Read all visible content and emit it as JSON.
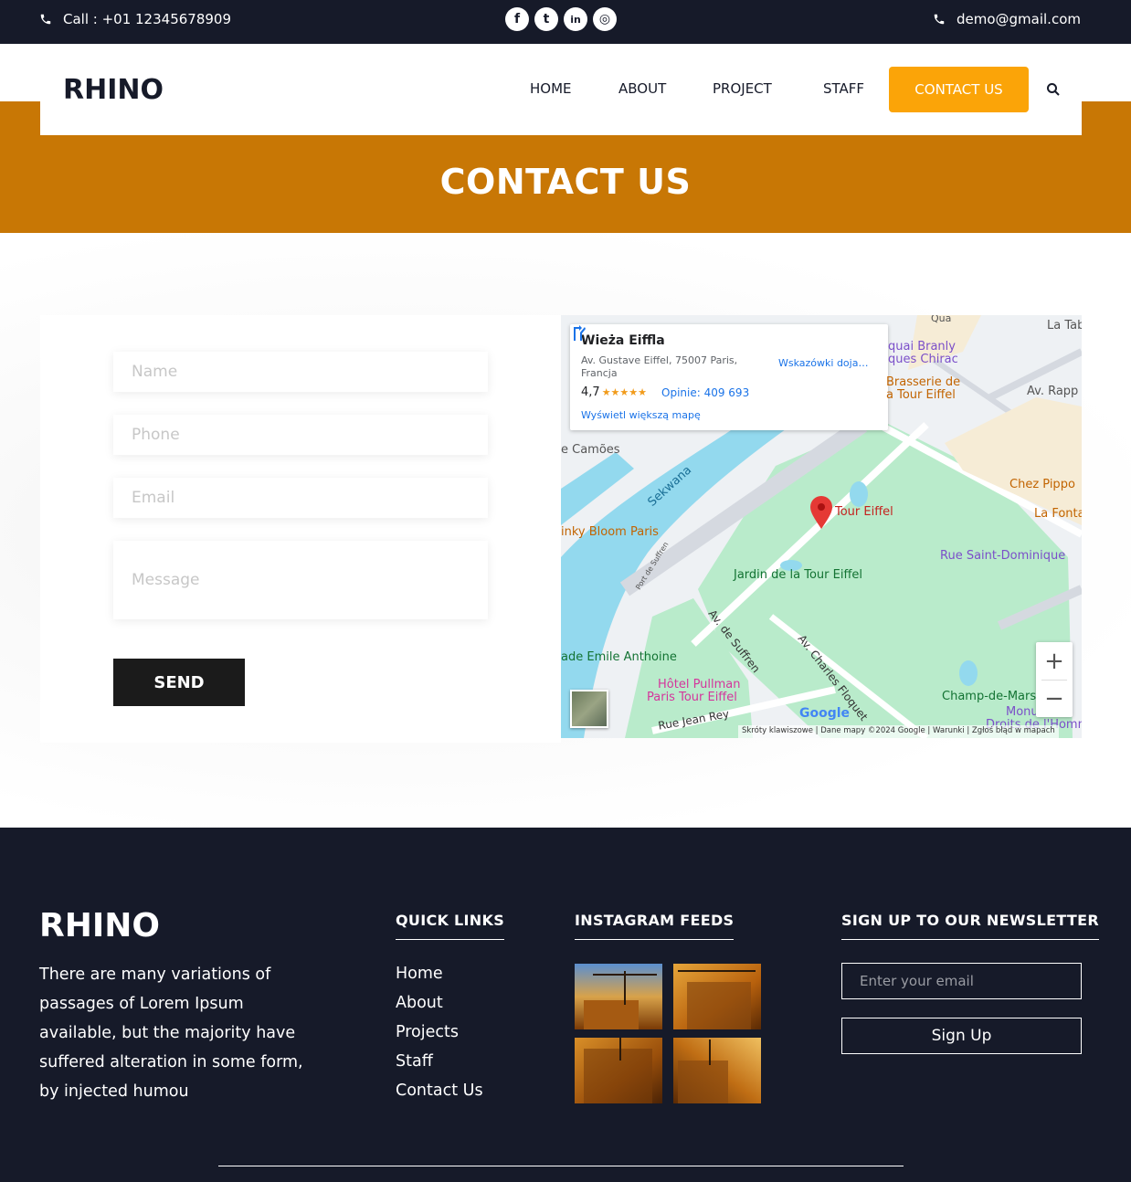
{
  "topbar": {
    "call": "Call : +01 12345678909",
    "email": "demo@gmail.com",
    "social": [
      {
        "icon": "facebook-icon",
        "glyph": "f"
      },
      {
        "icon": "twitter-icon",
        "glyph": "t"
      },
      {
        "icon": "linkedin-icon",
        "glyph": "in"
      },
      {
        "icon": "instagram-icon",
        "glyph": "◎"
      }
    ]
  },
  "nav": {
    "logo": "RHINO",
    "items": [
      "HOME",
      "ABOUT",
      "PROJECT",
      "STAFF"
    ],
    "cta": "CONTACT US"
  },
  "banner": {
    "title": "CONTACT US"
  },
  "form": {
    "name_placeholder": "Name",
    "phone_placeholder": "Phone",
    "email_placeholder": "Email",
    "message_placeholder": "Message",
    "send": "SEND"
  },
  "map": {
    "card": {
      "title": "Wieża Eiffla",
      "address": "Av. Gustave Eiffel, 75007 Paris, Francja",
      "rating": "4,7",
      "stars": "★★★★★",
      "reviews": "Opinie: 409 693",
      "bigger_map": "Wyświetl większą mapę",
      "directions": "Wskazówki doja…"
    },
    "labels": {
      "tour_eiffel": "Tour Eiffel",
      "jardin": "Jardin de la Tour Eiffel",
      "seine": "Sekwana",
      "camoes": "e Camões",
      "blinky": "inky Bloom Paris",
      "port": "Port de Suffren",
      "av_suffren": "Av. de Suffren",
      "av_floquet": "Av. Charles Floquet",
      "emile": "ade Emile Anthoine",
      "pullman_1": "Hôtel Pullman",
      "pullman_2": "Paris Tour Eiffel",
      "jean_rey": "Rue Jean Rey",
      "champ": "Champ-de-Mars",
      "chez_pippo": "Chez Pippo",
      "la_fonta": "La Fonta",
      "saint_dominique": "Rue Saint-Dominique",
      "brasserie_1": "Brasserie de",
      "brasserie_2": "a Tour Eiffel",
      "quai_1": "quai Branly",
      "quai_2": "ques Chirac",
      "av_rapp": "Av. Rapp",
      "la_tab": "La Tab",
      "quai": "Qua",
      "monu_1": "Monu",
      "monu_2": "Droits de l'Homm",
      "google": "Google"
    },
    "attribution": "Skróty klawiszowe   |   Dane mapy ©2024 Google   |   Warunki   |   Zgłoś błąd w mapach",
    "zoom_in": "+",
    "zoom_out": "−"
  },
  "footer": {
    "logo": "RHINO",
    "text": "There are many variations of passages of Lorem Ipsum available, but the majority have suffered alteration in some form, by injected humou",
    "quick_links_title": "QUICK LINKS",
    "quick_links": [
      "Home",
      "About",
      "Projects",
      "Staff",
      "Contact Us"
    ],
    "instagram_title": "INSTAGRAM FEEDS",
    "newsletter_title": "SIGN UP TO OUR NEWSLETTER",
    "email_placeholder": "Enter your email",
    "signup": "Sign Up"
  },
  "colors": {
    "dark": "#161a29",
    "banner": "#c87705",
    "cta": "#fba408",
    "send": "#1b1b1b"
  }
}
